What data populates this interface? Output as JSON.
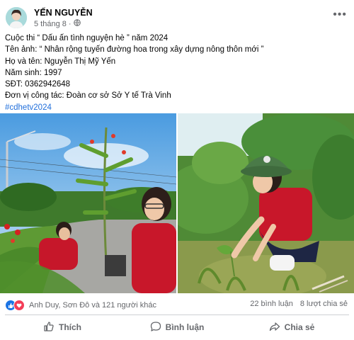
{
  "post": {
    "author": "YẾN NGUYỄN",
    "time": "5 tháng 8",
    "lines": [
      "Cuộc thi “ Dấu ấn tình nguyện hè ” năm 2024",
      "Tên ảnh: “ Nhân rộng tuyến đường hoa trong xây dựng nông thôn mới ”",
      "Họ và tên: Nguyễn Thị Mỹ Yến",
      "Năm sinh: 1997",
      "SĐT: 0362942648",
      "Đơn vị công tác: Đoàn cơ sở Sở Y tế Trà Vinh"
    ],
    "hashtag": "#cdhetv2024"
  },
  "stats": {
    "reactions_text": "Anh Duy, Sơn Đô và 121 người khác",
    "comments": "22 bình luận",
    "shares": "8 lượt chia sẻ"
  },
  "actions": {
    "like": "Thích",
    "comment": "Bình luận",
    "share": "Chia sẻ"
  },
  "icons": {
    "privacy": "globe-icon",
    "more": "more-options-icon",
    "like_reaction": "like-reaction-icon",
    "love_reaction": "love-reaction-icon"
  },
  "colors": {
    "link": "#216fdb",
    "like_blue": "#1b74e4",
    "love_red": "#f33e58",
    "secondary_text": "#65676b"
  }
}
